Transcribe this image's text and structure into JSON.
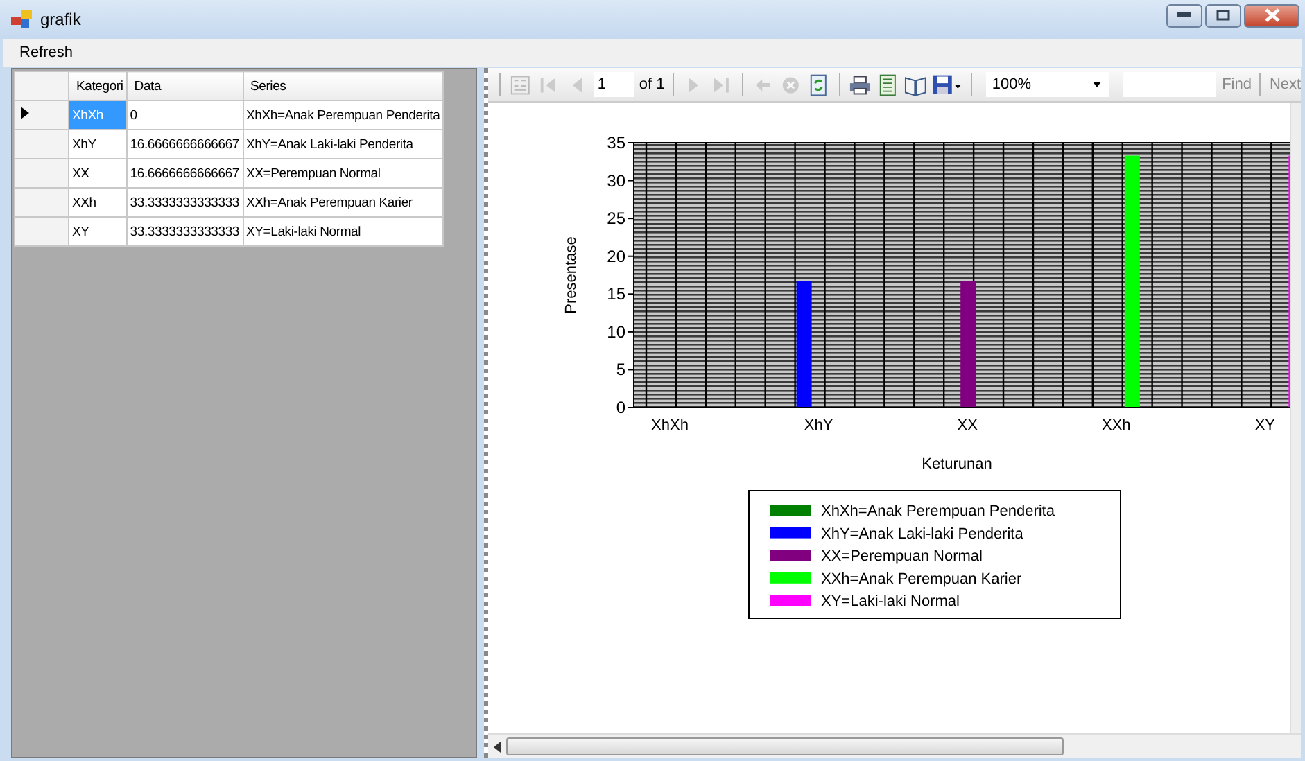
{
  "window": {
    "title": "grafik"
  },
  "menu": [
    "Refresh"
  ],
  "grid": {
    "columns": [
      "Kategori",
      "Data",
      "Series"
    ],
    "rows": [
      {
        "cells": [
          "XhXh",
          "0",
          "XhXh=Anak Perempuan Penderita"
        ],
        "selected": true
      },
      {
        "cells": [
          "XhY",
          "16.6666666666667",
          "XhY=Anak Laki-laki Penderita"
        ],
        "selected": false
      },
      {
        "cells": [
          "XX",
          "16.6666666666667",
          "XX=Perempuan Normal"
        ],
        "selected": false
      },
      {
        "cells": [
          "XXh",
          "33.3333333333333",
          "XXh=Anak Perempuan Karier"
        ],
        "selected": false
      },
      {
        "cells": [
          "XY",
          "33.3333333333333",
          "XY=Laki-laki Normal"
        ],
        "selected": false
      }
    ]
  },
  "toolbar": {
    "page": "1",
    "of": "of 1",
    "zoom": "100%",
    "find": "Find",
    "next": "Next",
    "buttons": [
      {
        "kind": "map",
        "disabled": true
      },
      {
        "kind": "first",
        "disabled": true
      },
      {
        "kind": "prev",
        "disabled": true
      },
      {
        "kind": "sep"
      },
      {
        "kind": "next",
        "disabled": true
      },
      {
        "kind": "last",
        "disabled": true
      },
      {
        "kind": "sep"
      },
      {
        "kind": "back",
        "disabled": true
      },
      {
        "kind": "stop",
        "disabled": true
      },
      {
        "kind": "refresh",
        "disabled": false
      },
      {
        "kind": "sep"
      },
      {
        "kind": "print",
        "disabled": false
      },
      {
        "kind": "layout",
        "disabled": false
      },
      {
        "kind": "setup",
        "disabled": false
      },
      {
        "kind": "save",
        "disabled": false
      }
    ]
  },
  "chart_data": {
    "type": "bar",
    "legend": "bottom",
    "xlabel": "Keturunan",
    "ylabel": "Presentase",
    "categories": [
      "XhXh",
      "XhY",
      "XX",
      "XXh",
      "XY"
    ],
    "ylim": [
      0,
      35
    ],
    "yticks": [
      0,
      5,
      10,
      15,
      20,
      25,
      30,
      35
    ],
    "series": [
      {
        "name": "XhXh=Anak Perempuan Penderita",
        "color": "#008000",
        "values": [
          0,
          null,
          null,
          null,
          null
        ]
      },
      {
        "name": "XhY=Anak Laki-laki Penderita",
        "color": "#0000ff",
        "values": [
          null,
          16.7,
          null,
          null,
          null
        ]
      },
      {
        "name": "XX=Perempuan Normal",
        "color": "#800080",
        "values": [
          null,
          null,
          16.7,
          null,
          null
        ]
      },
      {
        "name": "XXh=Anak Perempuan Karier",
        "color": "#00ff00",
        "values": [
          null,
          null,
          null,
          33.3,
          null
        ]
      },
      {
        "name": "XY=Laki-laki Normal",
        "color": "#ff00ff",
        "values": [
          null,
          null,
          null,
          null,
          33.3
        ]
      }
    ]
  }
}
